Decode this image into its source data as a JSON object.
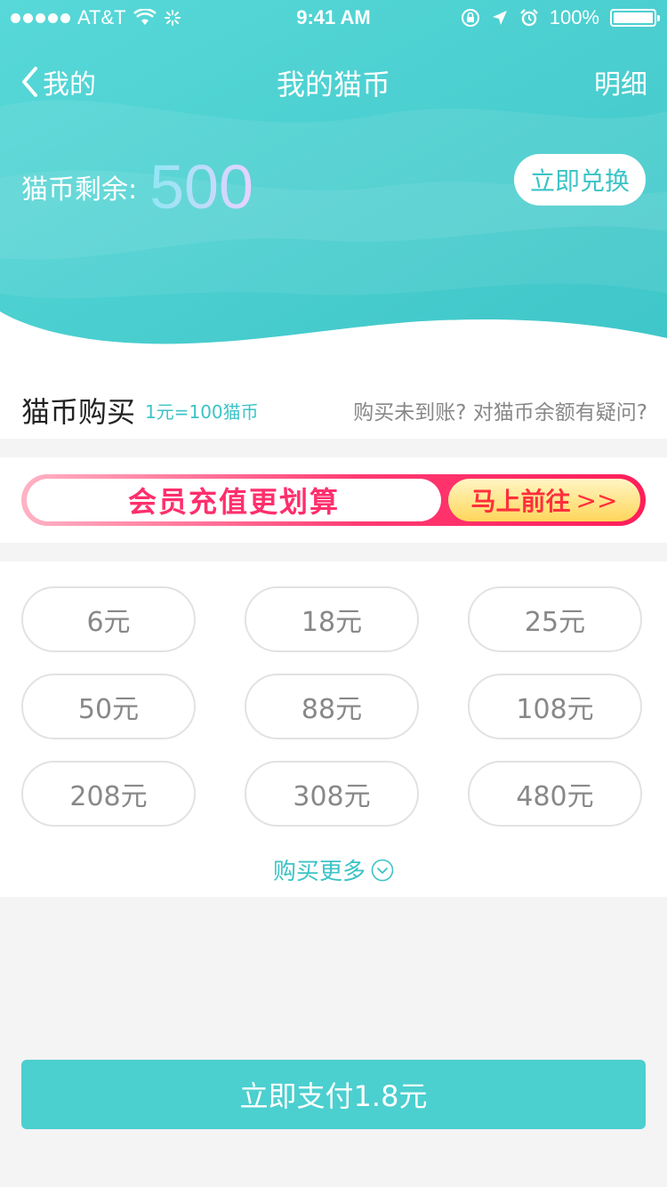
{
  "status_bar": {
    "carrier": "AT&T",
    "time": "9:41 AM",
    "battery": "100%",
    "battery_level": 1.0
  },
  "nav": {
    "back_label": "我的",
    "title": "我的猫币",
    "detail_label": "明细"
  },
  "balance": {
    "label": "猫币剩余:",
    "value": "500",
    "redeem_label": "立即兑换"
  },
  "purchase": {
    "title": "猫币购买",
    "rate": "1元=100猫币",
    "help_text": "购买未到账? 对猫币余额有疑问?"
  },
  "promo": {
    "text": "会员充值更划算",
    "go_label": "马上前往",
    "go_arrows": ">>"
  },
  "options": [
    {
      "label": "6元"
    },
    {
      "label": "18元"
    },
    {
      "label": "25元"
    },
    {
      "label": "50元"
    },
    {
      "label": "88元"
    },
    {
      "label": "108元"
    },
    {
      "label": "208元"
    },
    {
      "label": "308元"
    },
    {
      "label": "480元"
    }
  ],
  "more_label": "购买更多",
  "pay_button": "立即支付1.8元",
  "colors": {
    "accent": "#4ccfcf",
    "header_start": "#5ad9d9",
    "header_end": "#3cc3c6",
    "promo_pink": "#ff2f6c"
  }
}
